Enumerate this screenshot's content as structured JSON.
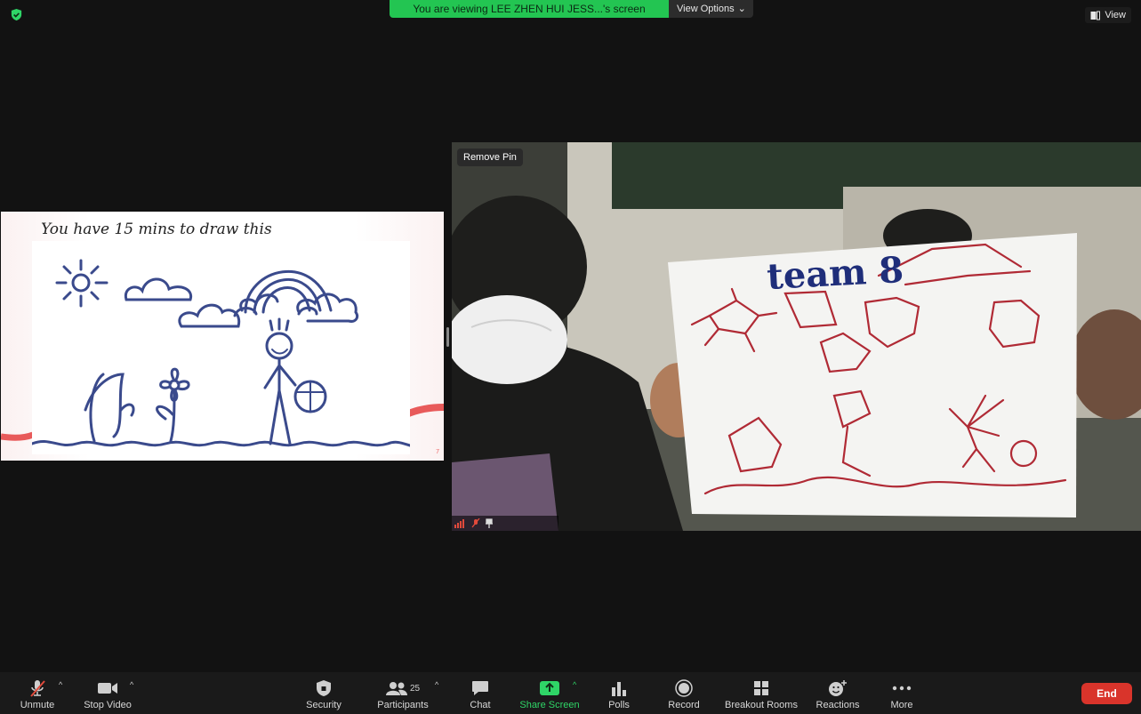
{
  "banner": {
    "message": "You are viewing LEE ZHEN HUI JESS...'s screen",
    "options_label": "View Options"
  },
  "view_button": {
    "label": "View"
  },
  "slide": {
    "title": "You have 15 mins to draw this",
    "page_number": "7"
  },
  "camera": {
    "remove_pin_label": "Remove Pin",
    "sign_text": "team 8"
  },
  "toolbar": {
    "unmute": "Unmute",
    "stop_video": "Stop Video",
    "security": "Security",
    "participants": "Participants",
    "participants_count": "25",
    "chat": "Chat",
    "share_screen": "Share Screen",
    "polls": "Polls",
    "record": "Record",
    "breakout_rooms": "Breakout Rooms",
    "reactions": "Reactions",
    "more": "More",
    "end": "End"
  },
  "colors": {
    "banner_green": "#23c552",
    "share_green": "#2fd567",
    "end_red": "#d9342b",
    "drawing_blue": "#3a4a8c",
    "marker_red": "#b02a35"
  }
}
